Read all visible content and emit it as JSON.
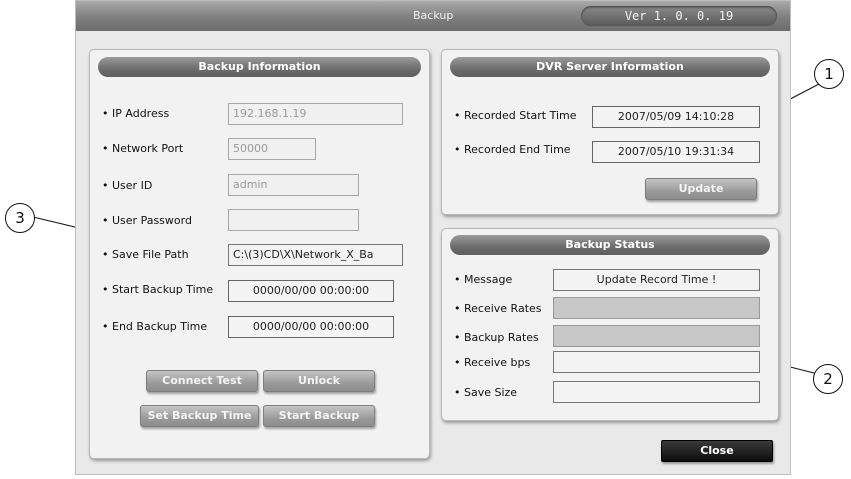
{
  "window": {
    "title": "Backup",
    "version": "Ver 1. 0. 0. 19"
  },
  "backup_info": {
    "header": "Backup Information",
    "ip_label": "IP Address",
    "ip_value": "192.168.1.19",
    "port_label": "Network Port",
    "port_value": "50000",
    "user_label": "User ID",
    "user_value": "admin",
    "password_label": "User Password",
    "password_value": "",
    "path_label": "Save File Path",
    "path_value": "C:\\(3)CD\\X\\Network_X_Ba",
    "start_label": "Start Backup Time",
    "start_value": "0000/00/00 00:00:00",
    "end_label": "End Backup Time",
    "end_value": "0000/00/00 00:00:00",
    "connect_test_label": "Connect Test",
    "unlock_label": "Unlock",
    "set_backup_time_label": "Set Backup Time",
    "start_backup_label": "Start Backup"
  },
  "dvr_info": {
    "header": "DVR Server Information",
    "rec_start_label": "Recorded Start Time",
    "rec_start_value": "2007/05/09 14:10:28",
    "rec_end_label": "Recorded End Time",
    "rec_end_value": "2007/05/10 19:31:34",
    "update_label": "Update"
  },
  "backup_status": {
    "header": "Backup Status",
    "message_label": "Message",
    "message_value": "Update Record Time !",
    "receive_rates_label": "Receive Rates",
    "backup_rates_label": "Backup Rates",
    "receive_bps_label": "Receive bps",
    "save_size_label": "Save Size"
  },
  "close_label": "Close",
  "callouts": {
    "one": "1",
    "two": "2",
    "three": "3"
  }
}
